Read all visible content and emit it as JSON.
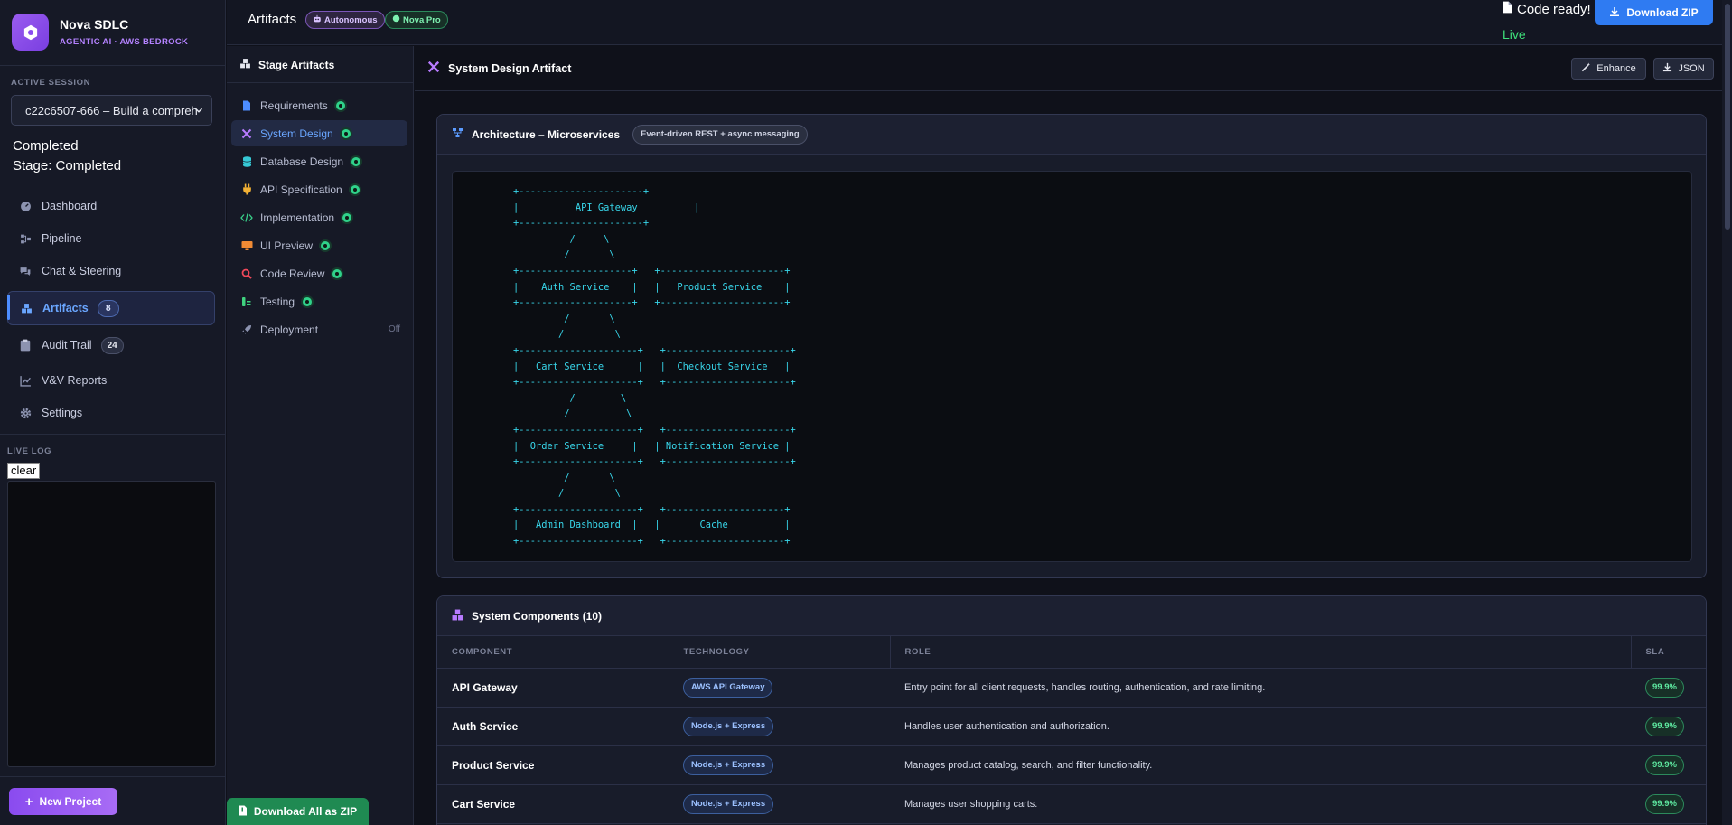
{
  "brand": {
    "name": "Nova SDLC",
    "subtitle": "AGENTIC AI · AWS BEDROCK"
  },
  "session": {
    "label": "ACTIVE SESSION",
    "selected": "c22c6507-666 – Build a compreh",
    "status": "Completed",
    "stage": "Stage: Completed"
  },
  "nav": {
    "dashboard": "Dashboard",
    "pipeline": "Pipeline",
    "chat": "Chat & Steering",
    "artifacts": "Artifacts",
    "artifacts_count": "8",
    "audit": "Audit Trail",
    "audit_count": "24",
    "vv": "V&V Reports",
    "settings": "Settings"
  },
  "livelog": {
    "label": "LIVE LOG",
    "clear": "clear"
  },
  "new_project": "New Project",
  "topbar": {
    "title": "Artifacts",
    "pill_autonomous": "Autonomous",
    "pill_nova": "Nova Pro",
    "code_ready": "Code ready!",
    "live": "Live",
    "download_zip": "Download ZIP"
  },
  "stage_panel": {
    "title": "Stage Artifacts",
    "items": [
      {
        "label": "Requirements"
      },
      {
        "label": "System Design"
      },
      {
        "label": "Database Design"
      },
      {
        "label": "API Specification"
      },
      {
        "label": "Implementation"
      },
      {
        "label": "UI Preview"
      },
      {
        "label": "Code Review"
      },
      {
        "label": "Testing"
      },
      {
        "label": "Deployment",
        "status": "Off"
      }
    ],
    "download_all": "Download All as ZIP"
  },
  "main": {
    "title": "System Design Artifact",
    "enhance": "Enhance",
    "json": "JSON",
    "arch_title": "Architecture – Microservices",
    "arch_tag": "Event-driven REST + async messaging",
    "ascii": "+----------------------+\n|          API Gateway          |\n+----------------------+\n          /     \\\n         /       \\\n+--------------------+   +----------------------+\n|    Auth Service    |   |   Product Service    |\n+--------------------+   +----------------------+\n         /       \\\n        /         \\\n+---------------------+   +----------------------+\n|   Cart Service      |   |  Checkout Service   |\n+---------------------+   +----------------------+\n          /        \\\n         /          \\\n+---------------------+   +----------------------+\n|  Order Service     |   | Notification Service |\n+---------------------+   +----------------------+\n         /       \\\n        /         \\\n+---------------------+   +---------------------+\n|   Admin Dashboard  |   |       Cache          |\n+---------------------+   +---------------------+",
    "components_title": "System Components (10)",
    "columns": {
      "component": "COMPONENT",
      "technology": "TECHNOLOGY",
      "role": "ROLE",
      "sla": "SLA"
    },
    "rows": [
      {
        "component": "API Gateway",
        "tech": "AWS API Gateway",
        "role": "Entry point for all client requests, handles routing, authentication, and rate limiting.",
        "sla": "99.9%"
      },
      {
        "component": "Auth Service",
        "tech": "Node.js + Express",
        "role": "Handles user authentication and authorization.",
        "sla": "99.9%"
      },
      {
        "component": "Product Service",
        "tech": "Node.js + Express",
        "role": "Manages product catalog, search, and filter functionality.",
        "sla": "99.9%"
      },
      {
        "component": "Cart Service",
        "tech": "Node.js + Express",
        "role": "Manages user shopping carts.",
        "sla": "99.9%"
      }
    ]
  }
}
